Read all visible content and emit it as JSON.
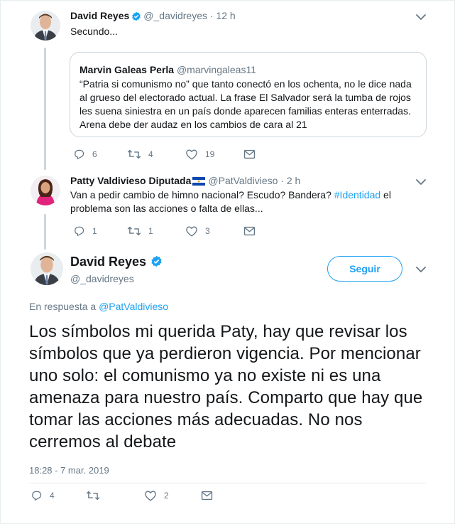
{
  "tweet1": {
    "name": "David Reyes",
    "handle": "@_davidreyes",
    "time": "· 12 h",
    "text": "Secundo...",
    "quote": {
      "name": "Marvin Galeas Perla",
      "handle": "@marvingaleas11",
      "text": "“Patria si comunismo no” que tanto conectó en los ochenta, no le dice nada al grueso del electorado actual. La frase El Salvador será la tumba de rojos les suena siniestra en un país donde aparecen familias enteras enterradas. Arena debe der audaz en los cambios de cara al 21"
    },
    "actions": {
      "replies": "6",
      "retweets": "4",
      "likes": "19"
    }
  },
  "tweet2": {
    "name": "Patty Valdivieso Diputada",
    "handle": "@PatValdivieso",
    "time": "· 2 h",
    "text_before": "Van a pedir cambio de himno nacional? Escudo? Bandera? ",
    "hashtag": "#Identidad",
    "text_after": " el problema son las acciones o falta de ellas...",
    "actions": {
      "replies": "1",
      "retweets": "1",
      "likes": "3"
    }
  },
  "main_tweet": {
    "name": "David Reyes",
    "handle": "@_davidreyes",
    "follow_label": "Seguir",
    "reply_prefix": "En respuesta a ",
    "reply_handle": "@PatValdivieso",
    "text": "Los símbolos mi querida Paty, hay que revisar los símbolos que ya perdieron vigencia. Por mencionar uno solo: el comunismo ya no existe ni es una amenaza para nuestro país. Comparto que hay que tomar las acciones más adecuadas. No nos cerremos al debate",
    "timestamp": "18:28 - 7 mar. 2019",
    "actions": {
      "replies": "4",
      "retweets": "",
      "likes": "2"
    }
  },
  "icons": {
    "verified": "verified-badge-icon",
    "flag": "el-salvador-flag-icon",
    "reply": "reply-icon",
    "retweet": "retweet-icon",
    "like": "heart-icon",
    "dm": "envelope-icon",
    "more": "chevron-down-icon"
  },
  "colors": {
    "accent": "#1da1f2",
    "text": "#14171a",
    "secondary": "#657786",
    "border": "#ccd6dd"
  }
}
